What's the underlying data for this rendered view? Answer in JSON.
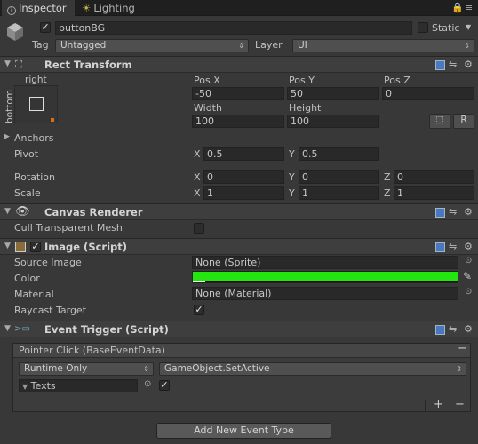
{
  "tabs": [
    {
      "label": "Inspector"
    },
    {
      "label": "Lighting"
    }
  ],
  "header": {
    "name": "buttonBG",
    "static_label": "Static",
    "tag_label": "Tag",
    "tag_value": "Untagged",
    "layer_label": "Layer",
    "layer_value": "UI"
  },
  "rect": {
    "title": "Rect Transform",
    "anchor_top": "right",
    "anchor_side": "bottom",
    "pos_labels": [
      "Pos X",
      "Pos Y",
      "Pos Z"
    ],
    "pos_values": [
      "-50",
      "50",
      "0"
    ],
    "size_labels": [
      "Width",
      "Height"
    ],
    "size_values": [
      "100",
      "100"
    ],
    "r_label": "R",
    "anchors_label": "Anchors",
    "pivot_label": "Pivot",
    "pivot": {
      "x": "0.5",
      "y": "0.5"
    },
    "rotation_label": "Rotation",
    "rotation": {
      "x": "0",
      "y": "0",
      "z": "0"
    },
    "scale_label": "Scale",
    "scale": {
      "x": "1",
      "y": "1",
      "z": "1"
    },
    "axis": {
      "x": "X",
      "y": "Y",
      "z": "Z"
    }
  },
  "canvas": {
    "title": "Canvas Renderer",
    "cull_label": "Cull Transparent Mesh"
  },
  "image": {
    "title": "Image (Script)",
    "source_label": "Source Image",
    "source_value": "None (Sprite)",
    "color_label": "Color",
    "color_value": "#22e60e",
    "material_label": "Material",
    "material_value": "None (Material)",
    "raycast_label": "Raycast Target"
  },
  "trigger": {
    "title": "Event Trigger (Script)",
    "event_header": "Pointer Click (BaseEventData)",
    "runtime_value": "Runtime Only",
    "function_value": "GameObject.SetActive",
    "object_value": "Texts",
    "plus": "+",
    "minus": "−",
    "add_button": "Add New Event Type"
  }
}
